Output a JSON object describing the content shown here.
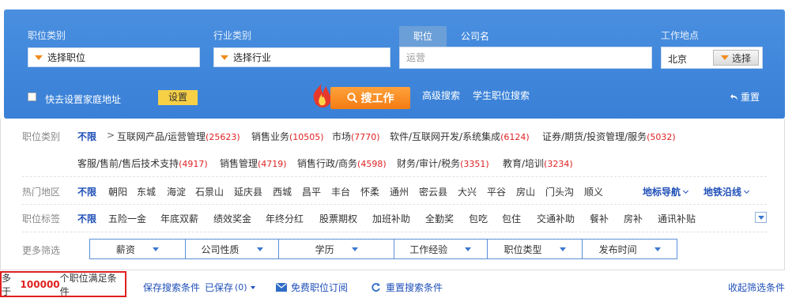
{
  "search": {
    "job_category_label": "职位类别",
    "job_category_value": "选择职位",
    "industry_label": "行业类别",
    "industry_value": "选择行业",
    "tabs": [
      "职位",
      "公司名"
    ],
    "keyword_placeholder": "运营",
    "location_label": "工作地点",
    "location_value": "北京",
    "location_button": "选择",
    "home_address_label": "快去设置家庭地址",
    "settings_button": "设置",
    "search_button": "搜工作",
    "advanced_search": "高级搜索",
    "student_search": "学生职位搜索",
    "reset": "重置"
  },
  "filters": {
    "category": {
      "label": "职位类别",
      "unlimited": "不限",
      "row1": [
        {
          "name": "互联网产品/运营管理",
          "count": "(25623)"
        },
        {
          "name": "销售业务",
          "count": "(10505)"
        },
        {
          "name": "市场",
          "count": "(7770)"
        },
        {
          "name": "软件/互联网开发/系统集成",
          "count": "(6124)"
        },
        {
          "name": "证券/期货/投资管理/服务",
          "count": "(5032)"
        }
      ],
      "row2": [
        {
          "name": "客服/售前/售后技术支持",
          "count": "(4917)"
        },
        {
          "name": "销售管理",
          "count": "(4719)"
        },
        {
          "name": "销售行政/商务",
          "count": "(4598)"
        },
        {
          "name": "财务/审计/税务",
          "count": "(3351)"
        },
        {
          "name": "教育/培训",
          "count": "(3234)"
        }
      ]
    },
    "district": {
      "label": "热门地区",
      "unlimited": "不限",
      "items": [
        "朝阳",
        "东城",
        "海淀",
        "石景山",
        "延庆县",
        "西城",
        "昌平",
        "丰台",
        "怀柔",
        "通州",
        "密云县",
        "大兴",
        "平谷",
        "房山",
        "门头沟",
        "顺义"
      ],
      "landmark_nav": "地标导航",
      "subway": "地铁沿线"
    },
    "tags": {
      "label": "职位标签",
      "unlimited": "不限",
      "items": [
        "五险一金",
        "年底双薪",
        "绩效奖金",
        "年终分红",
        "股票期权",
        "加班补助",
        "全勤奖",
        "包吃",
        "包住",
        "交通补助",
        "餐补",
        "房补",
        "通讯补贴"
      ]
    },
    "more": {
      "label": "更多筛选",
      "items": [
        "薪资",
        "公司性质",
        "学历",
        "工作经验",
        "职位类型",
        "发布时间"
      ]
    }
  },
  "results": {
    "prefix": "多于",
    "count": "100000",
    "suffix": "个职位满足条件",
    "save_search": "保存搜索条件",
    "saved": "已保存",
    "saved_count": "(0)",
    "subscribe": "免费职位订阅",
    "reset_search": "重置搜索条件",
    "collapse": "收起筛选条件"
  },
  "colors": {
    "panel_blue": "#3f86db",
    "search_orange": "#f47b12",
    "link_blue": "#1f4fb8",
    "count_red": "#e02020"
  }
}
